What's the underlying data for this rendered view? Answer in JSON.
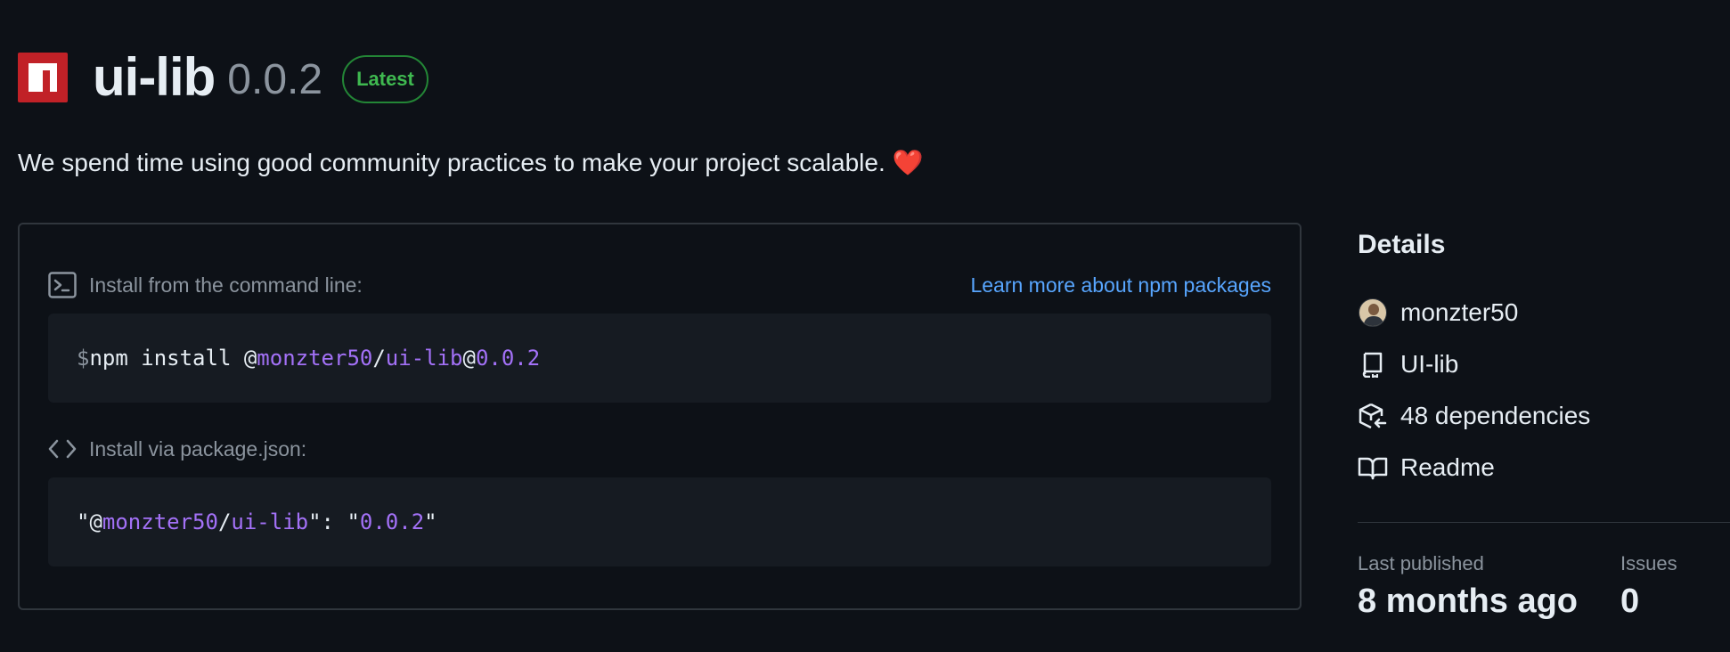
{
  "package": {
    "name": "ui-lib",
    "version": "0.0.2",
    "badge": "Latest",
    "description": "We spend time using good community practices to make your project scalable.",
    "description_emoji": "❤️"
  },
  "install": {
    "cmd_label": "Install from the command line:",
    "learn_more": "Learn more about npm packages",
    "cmd": {
      "prompt": "$",
      "prefix": "npm install @",
      "scope": "monzter50",
      "slash": "/",
      "name": "ui-lib",
      "at": "@",
      "version": "0.0.2"
    },
    "json_label": "Install via package.json:",
    "json": {
      "q1": "\"@",
      "scope": "monzter50",
      "slash": "/",
      "name": "ui-lib",
      "mid": "\": \"",
      "version": "0.0.2",
      "q2": "\""
    }
  },
  "details": {
    "title": "Details",
    "items": [
      {
        "icon": "avatar",
        "label": "monzter50"
      },
      {
        "icon": "repo-icon",
        "label": "UI-lib"
      },
      {
        "icon": "package-dependencies-icon",
        "label": "48 dependencies"
      },
      {
        "icon": "book-icon",
        "label": "Readme"
      }
    ],
    "stats": [
      {
        "label": "Last published",
        "value": "8 months ago"
      },
      {
        "label": "Issues",
        "value": "0"
      }
    ]
  }
}
